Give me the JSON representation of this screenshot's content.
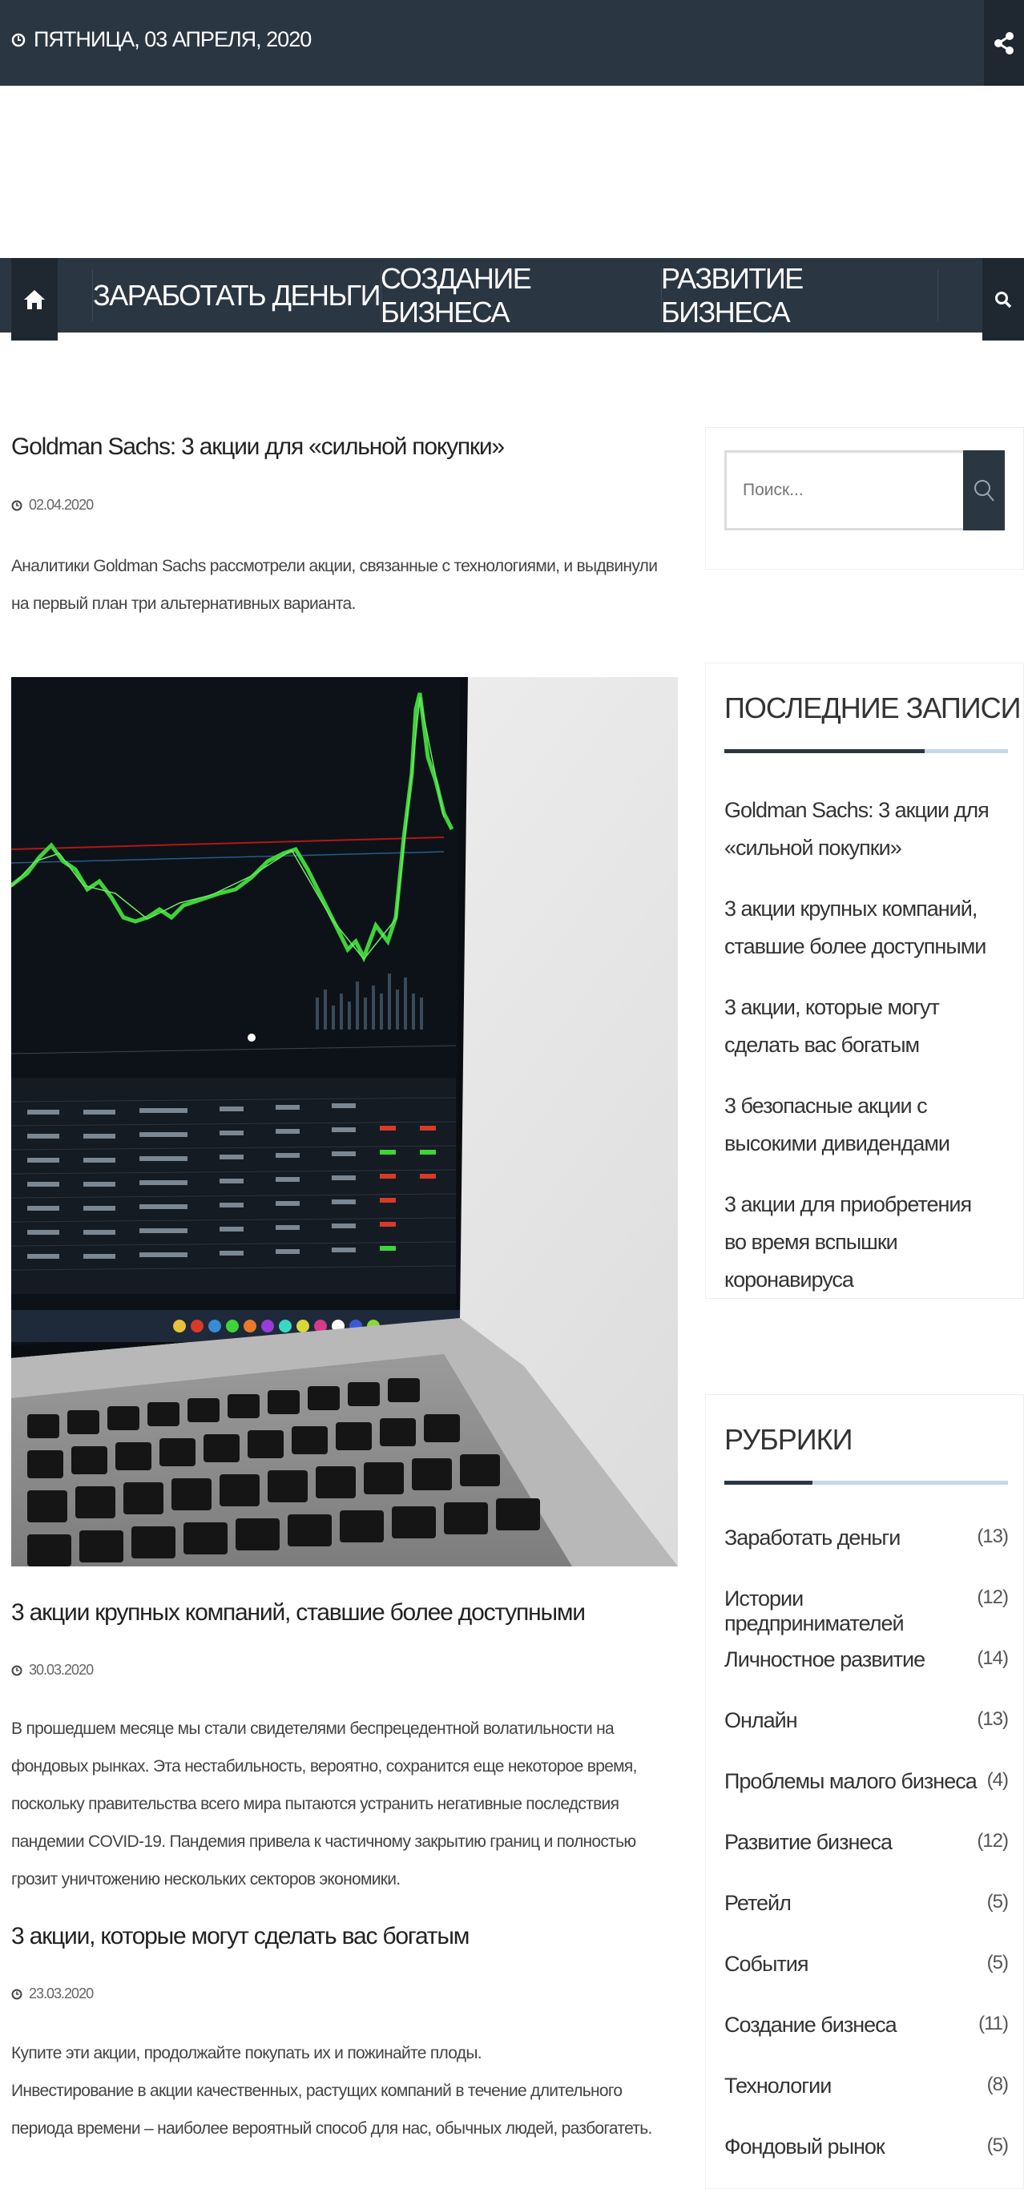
{
  "topbar": {
    "date": "ПЯТНИЦА, 03 АПРЕЛЯ, 2020",
    "clock_icon": "clock-icon",
    "share_icon": "share-icon"
  },
  "nav": {
    "home_icon": "home-icon",
    "items": [
      "ЗАРАБОТАТЬ ДЕНЬГИ",
      "СОЗДАНИЕ БИЗНЕСА",
      "РАЗВИТИЕ БИЗНЕСА"
    ],
    "search_icon": "search-icon"
  },
  "posts": [
    {
      "title": "Goldman Sachs: 3 акции для «сильной покупки»",
      "date": "02.04.2020",
      "excerpt": "Аналитики Goldman Sachs рассмотрели акции, связанные с технологиями, и выдвинули на первый план три альтернативных варианта."
    },
    {
      "title": "3 акции крупных компаний, ставшие более доступными",
      "date": "30.03.2020",
      "excerpt": "В прошедшем месяце мы стали свидетелями беспрецедентной волатильности на фондовых рынках. Эта нестабильность, вероятно, сохранится еще некоторое время, поскольку правительства всего мира пытаются устранить негативные последствия пандемии COVID-19. Пандемия привела к частичному закрытию границ и полностью грозит уничтожению нескольких секторов экономики."
    },
    {
      "title": "3 акции, которые могут сделать вас богатым",
      "date": "23.03.2020",
      "excerpt_line1": "Купите эти акции, продолжайте покупать их и пожинайте плоды.",
      "excerpt_line2": "Инвестирование в акции качественных, растущих компаний в течение длительного периода времени – наиболее вероятный способ для нас, обычных людей, разбогатеть."
    }
  ],
  "sidebar": {
    "search_placeholder": "Поиск...",
    "recent_title": "ПОСЛЕДНИЕ ЗАПИСИ",
    "recent": [
      "Goldman Sachs: 3 акции для «сильной покупки»",
      "3 акции крупных компаний, ставшие более доступными",
      "3 акции, которые могут сделать вас богатым",
      "3 безопасные акции с высокими дивидендами",
      "3 акции для приобретения во время вспышки коронавируса"
    ],
    "categories_title": "РУБРИКИ",
    "categories": [
      {
        "name": "Заработать деньги",
        "count": "(13)"
      },
      {
        "name": "Истории предпринимателей",
        "count": "(12)"
      },
      {
        "name": "Личностное развитие",
        "count": "(14)"
      },
      {
        "name": "Онлайн",
        "count": "(13)"
      },
      {
        "name": "Проблемы малого бизнеса",
        "count": "(4)"
      },
      {
        "name": "Развитие бизнеса",
        "count": "(12)"
      },
      {
        "name": "Ретейл",
        "count": "(5)"
      },
      {
        "name": "События",
        "count": "(5)"
      },
      {
        "name": "Создание бизнеса",
        "count": "(11)"
      },
      {
        "name": "Технологии",
        "count": "(8)"
      },
      {
        "name": "Фондовый рынок",
        "count": "(5)"
      }
    ]
  },
  "colors": {
    "dark": "#2b3643",
    "darker": "#1f2731",
    "accent_line": "#c7d6ea",
    "chart_green": "#3fd43a"
  }
}
